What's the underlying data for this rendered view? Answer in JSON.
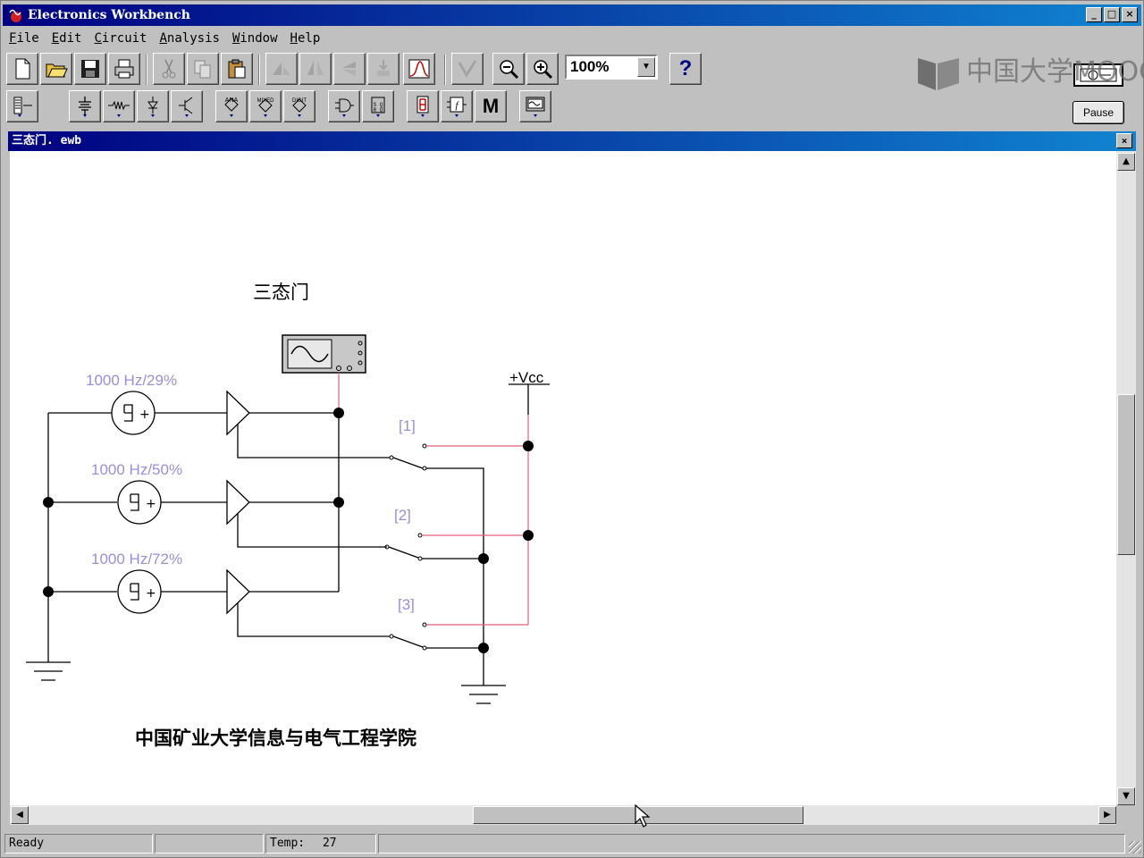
{
  "app": {
    "title": "Electronics Workbench"
  },
  "window_buttons": {
    "minimize": "_",
    "maximize": "□",
    "close": "×"
  },
  "menu": [
    {
      "label": "File",
      "accel": "F",
      "rest": "ile"
    },
    {
      "label": "Edit",
      "accel": "E",
      "rest": "dit"
    },
    {
      "label": "Circuit",
      "accel": "C",
      "rest": "ircuit"
    },
    {
      "label": "Analysis",
      "accel": "A",
      "rest": "nalysis"
    },
    {
      "label": "Window",
      "accel": "W",
      "rest": "indow"
    },
    {
      "label": "Help",
      "accel": "H",
      "rest": "elp"
    }
  ],
  "toolbar": {
    "zoom_value": "100%",
    "help_label": "?"
  },
  "parts_bin": {
    "ana_label": "ANA",
    "mixed_label": "MIXED",
    "digit_label": "DIGIT",
    "misc_label": "M"
  },
  "watermark": {
    "text": "中国大学MOOC"
  },
  "pause_button": {
    "label": "Pause"
  },
  "document": {
    "title": "三态门. ewb"
  },
  "circuit": {
    "title": "三态门",
    "source1_label": "1000 Hz/29%",
    "source2_label": "1000 Hz/50%",
    "source3_label": "1000 Hz/72%",
    "switch1_label": "[1]",
    "switch2_label": "[2]",
    "switch3_label": "[3]",
    "vcc_label": "+Vcc",
    "footer": "中国矿业大学信息与电气工程学院"
  },
  "statusbar": {
    "status": "Ready",
    "temp_label": "Temp:",
    "temp_value": "27"
  },
  "colors": {
    "titlebar_start": "#000080",
    "titlebar_end": "#1084d0",
    "label_purple": "#9a8fd6",
    "wire_red": "#e0607a"
  }
}
